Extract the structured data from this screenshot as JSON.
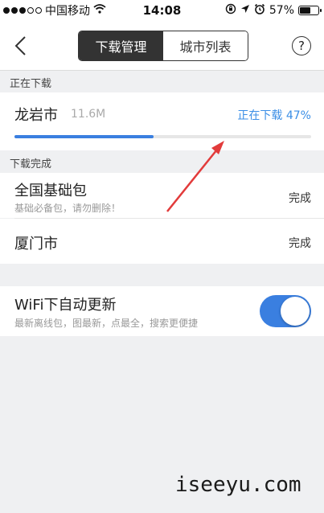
{
  "status_bar": {
    "carrier": "中国移动",
    "time": "14:08",
    "battery": "57%",
    "battery_level": 0.57,
    "signal_filled": 3,
    "signal_total": 5
  },
  "nav": {
    "tabs": [
      {
        "label": "下载管理",
        "active": true
      },
      {
        "label": "城市列表",
        "active": false
      }
    ],
    "help_label": "?"
  },
  "downloading": {
    "section_title": "正在下载",
    "item": {
      "name": "龙岩市",
      "size": "11.6M",
      "status": "正在下载 47%",
      "progress": 0.47
    }
  },
  "completed": {
    "section_title": "下载完成",
    "items": [
      {
        "name": "全国基础包",
        "subtitle": "基础必备包，请勿删除！",
        "status": "完成"
      },
      {
        "name": "厦门市",
        "subtitle": "",
        "status": "完成"
      }
    ]
  },
  "wifi_update": {
    "title": "WiFi下自动更新",
    "subtitle": "最新离线包，图最新，点最全，搜索更便捷",
    "enabled": true
  },
  "watermark": "iseeyu.com",
  "colors": {
    "accent": "#3a7fe0",
    "status_blue": "#3a8ee6",
    "annotation_red": "#e23b3b",
    "background": "#eff0f2"
  }
}
